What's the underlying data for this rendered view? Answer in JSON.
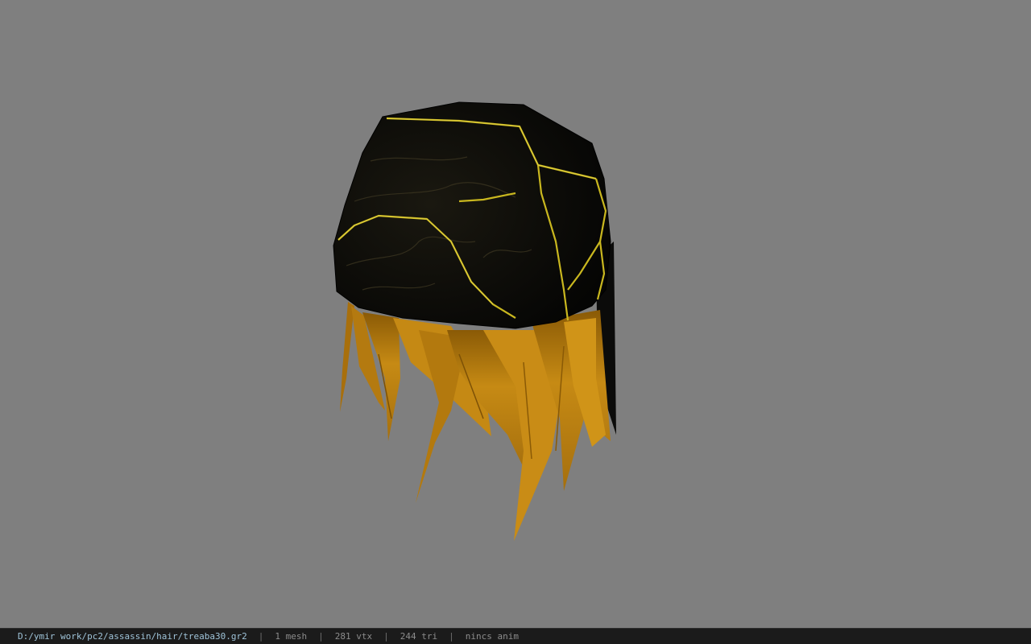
{
  "viewport": {
    "background": "#7f7f7f",
    "model": {
      "name": "hair-bandana-model",
      "cap_color": "#0a0a08",
      "vein_color": "#c9b71f",
      "hair_color": "#c68a14"
    }
  },
  "status_bar": {
    "file_path": "D:/ymir work/pc2/assassin/hair/treaba30.gr2",
    "separator": "|",
    "mesh_count": "1 mesh",
    "vertex_count": "281 vtx",
    "triangle_count": "244 tri",
    "animation_status": "nincs anim"
  }
}
